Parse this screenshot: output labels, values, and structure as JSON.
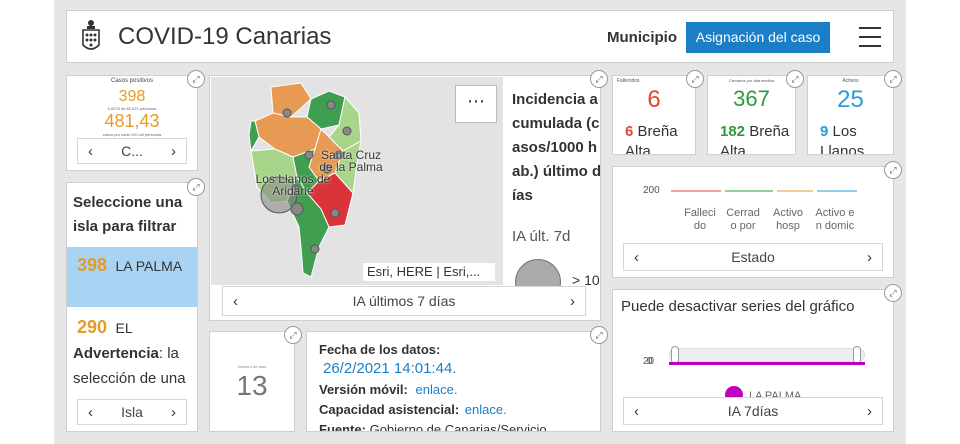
{
  "header": {
    "title": "COVID-19 Canarias",
    "municipio_label": "Municipio",
    "case_button": "Asignación del caso",
    "logo_icon": "canarias-coat-of-arms",
    "menu_icon": "hamburger-icon"
  },
  "casos": {
    "label": "Casos positivos",
    "value": "398",
    "sub": "0,0078 de 82.671 personas",
    "rate": "481,43",
    "rate_sub": "casos por cada 100 mil personas",
    "pager": "C..."
  },
  "isla": {
    "title": "Seleccione una isla para filtrar",
    "items": [
      {
        "value": "398",
        "name": "LA PALMA",
        "selected": true
      },
      {
        "value": "290",
        "name": "EL"
      }
    ],
    "warning_bold": "Advertencia",
    "warning_text": ": la selección de una isla",
    "pager": "Isla"
  },
  "map": {
    "towns": [
      "Santa Cruz de la Palma",
      "Los Llanos de Aridane"
    ],
    "attribution": "Esri, HERE | Esri,...",
    "more_icon": "more-dots-icon",
    "pager": "IA últimos 7 días"
  },
  "incidencia": {
    "title": "Incidencia acumulada (casos/1000 hab.) último días",
    "ia_label": "IA últ. 7d",
    "legend_text": "> 10"
  },
  "fallecidos": {
    "label": "Fallecidos",
    "value": "6",
    "sub_value": "6",
    "sub_name": "Breña Alta"
  },
  "cerrados": {
    "label": "Cerrados por alta médica",
    "value": "367",
    "sub_value": "182",
    "sub_name": "Breña Alta"
  },
  "activos": {
    "label": "Activos",
    "value": "25",
    "sub_value": "9",
    "sub_name": "Los Llanos"
  },
  "estado": {
    "ytick": "200",
    "categories": [
      "Fallecido",
      "Cerrado por",
      "Activo hosp",
      "Activo en domic"
    ],
    "pager": "Estado"
  },
  "chart_data": [
    {
      "type": "bar",
      "title": "",
      "categories": [
        "Fallecido",
        "Cerrado por",
        "Activo hosp",
        "Activo en domic"
      ],
      "yticks": [
        "200"
      ]
    },
    {
      "type": "line",
      "title": "Puede desactivar series del gráfico",
      "yticks": [
        "20",
        "0"
      ],
      "series": [
        {
          "name": "LA PALMA",
          "color": "#c000c0"
        }
      ]
    }
  ],
  "serie": {
    "title": "Puede desactivar series del gráfico",
    "ytick_top": "20",
    "ytick_bot": "0",
    "legend": "LA PALMA",
    "pager": "IA 7días"
  },
  "fecha": {
    "value": "13",
    "caption": "Número de días"
  },
  "info": {
    "fecha_label": "Fecha de los datos:",
    "fecha_value": "26/2/2021 14:01:44.",
    "movil_label": "Versión móvil:",
    "movil_link": "enlace",
    "movil_dot": ".",
    "cap_label": "Capacidad asistencial:",
    "cap_link": "enlace.",
    "fuente_label": "Fuente:",
    "fuente_text": "Gobierno de Canarias/Servicio"
  },
  "colors": {
    "accent": "#1a7fc7",
    "orange": "#e69a28",
    "green": "#2e9a3a",
    "blue": "#2a9bd6",
    "red": "#e04a2f",
    "magenta": "#c000c0"
  }
}
